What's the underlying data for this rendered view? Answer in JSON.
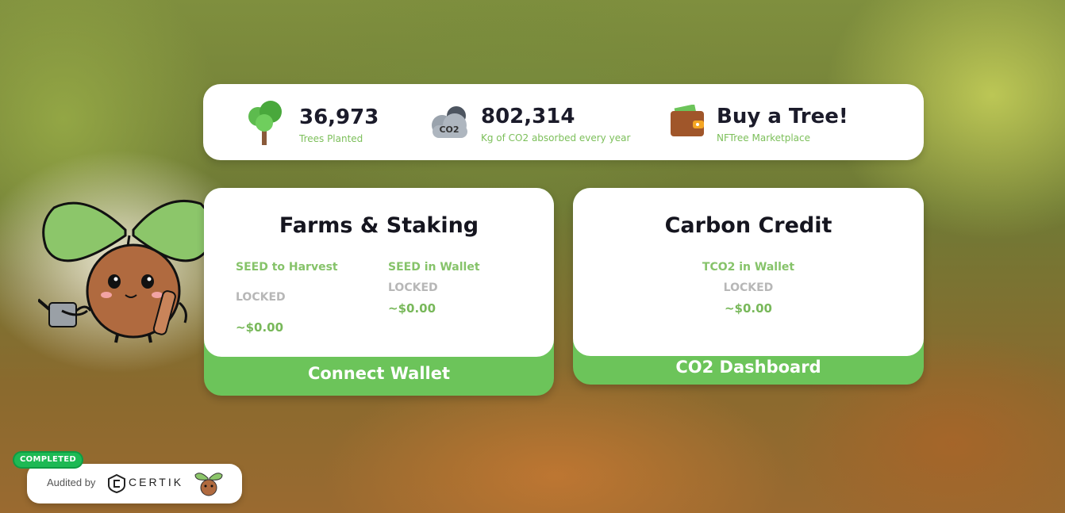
{
  "stats": {
    "trees": {
      "value": "36,973",
      "caption": "Trees Planted",
      "icon": "tree-icon"
    },
    "co2": {
      "value": "802,314",
      "caption": "Kg of CO2 absorbed every year",
      "icon": "co2-cloud-icon",
      "icon_text": "CO2"
    },
    "buy": {
      "value": "Buy a Tree!",
      "caption": "NFTree Marketplace",
      "icon": "wallet-icon"
    }
  },
  "farms_card": {
    "title": "Farms & Staking",
    "harvest_label": "SEED to Harvest",
    "harvest_status": "LOCKED",
    "harvest_value": "~$0.00",
    "wallet_label": "SEED in Wallet",
    "wallet_status": "LOCKED",
    "wallet_value": "~$0.00",
    "button": "Connect Wallet"
  },
  "carbon_card": {
    "title": "Carbon Credit",
    "label": "TCO2 in Wallet",
    "status": "LOCKED",
    "value": "~$0.00",
    "button": "CO2 Dashboard"
  },
  "audit": {
    "badge": "COMPLETED",
    "text": "Audited by",
    "brand": "CERTIK"
  },
  "colors": {
    "accent_green": "#6cc45a",
    "caption_green": "#7cbf5a",
    "locked_gray": "#b7b7b7"
  }
}
